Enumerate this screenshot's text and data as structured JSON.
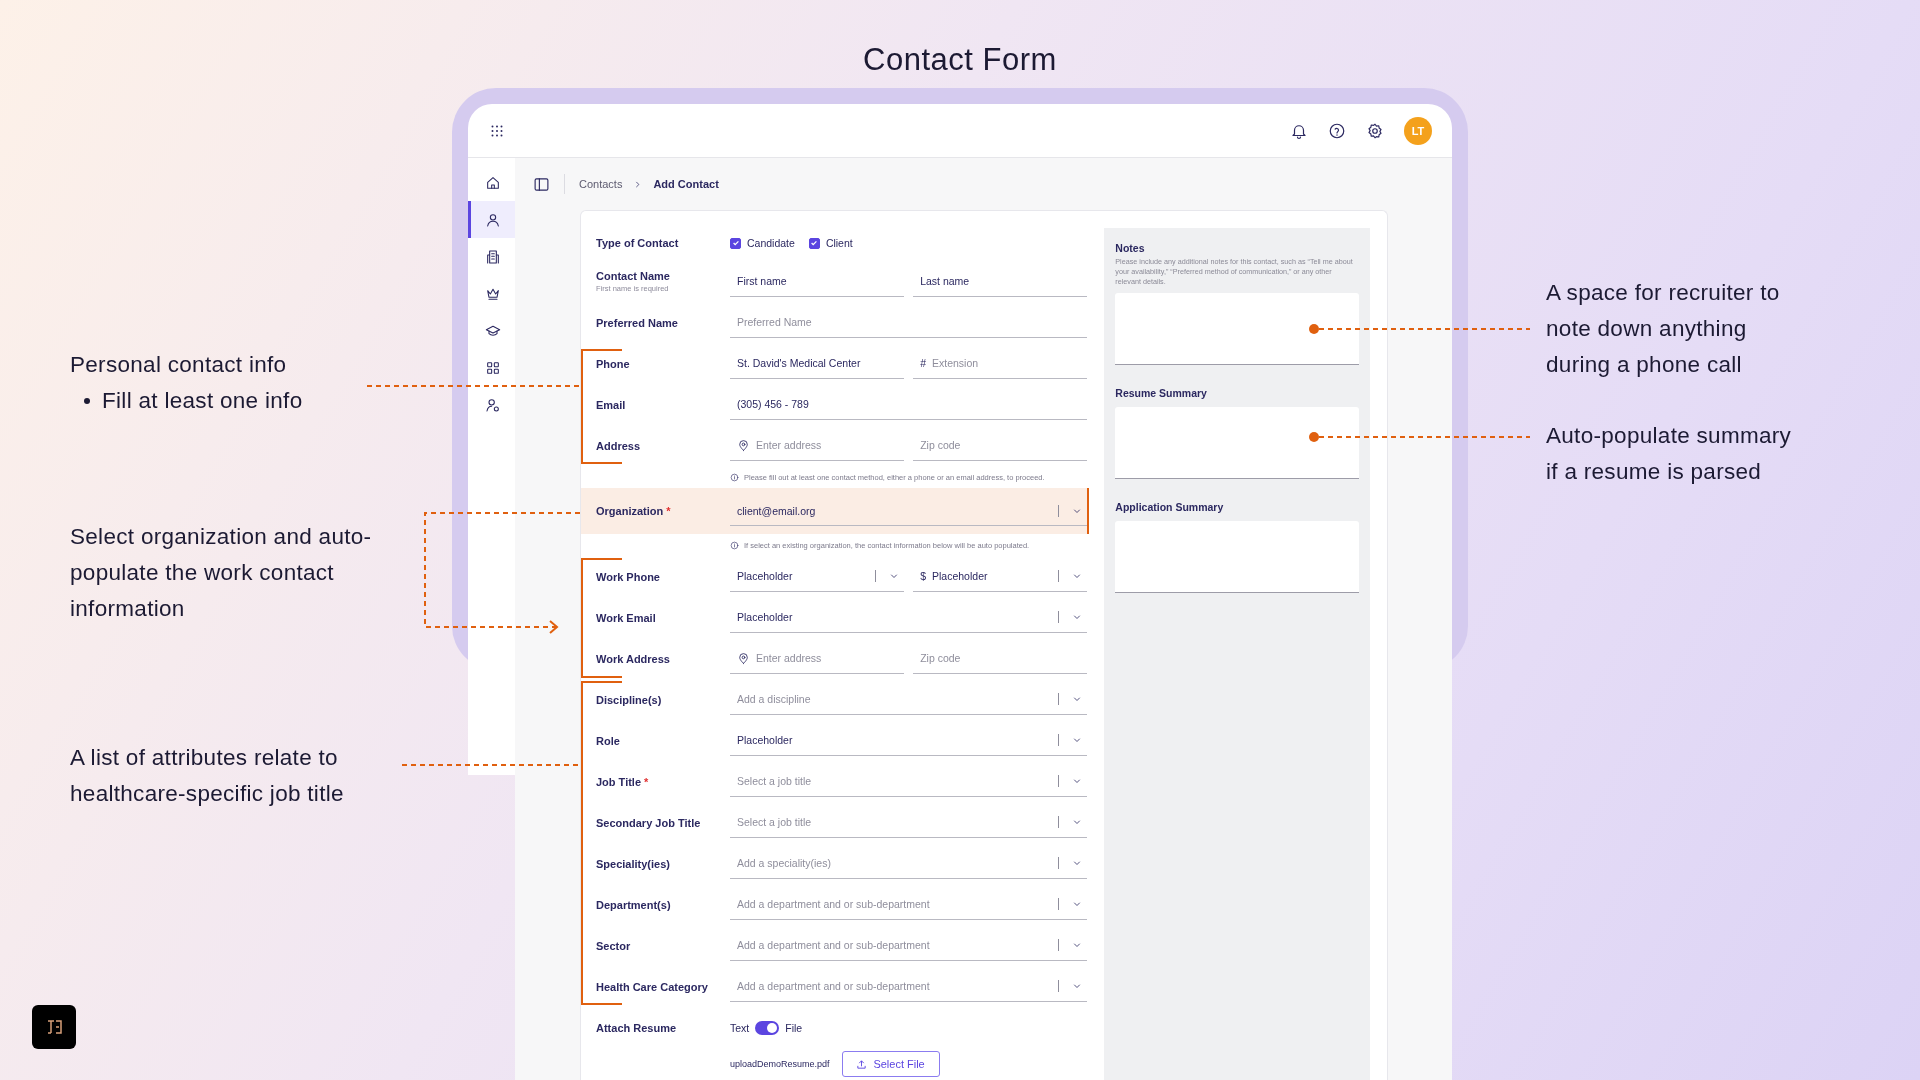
{
  "slide_title": "Contact Form",
  "app": {
    "avatar": "LT",
    "sidebar": [
      {
        "selected": false
      },
      {
        "selected": true
      },
      {
        "selected": false
      },
      {
        "selected": false
      },
      {
        "selected": false
      },
      {
        "selected": false
      },
      {
        "selected": false
      }
    ],
    "breadcrumb": [
      "Contacts",
      "Add Contact"
    ],
    "rows": [
      {
        "kind": "checkboxes",
        "label": "Type of Contact",
        "options": [
          {
            "label": "Candidate",
            "checked": true
          },
          {
            "label": "Client",
            "checked": true
          }
        ]
      },
      {
        "kind": "fields",
        "label": "Contact Name",
        "sublabel": "First name is required",
        "highlighted": false,
        "fields": [
          {
            "kind": "text",
            "value": "First name"
          },
          {
            "kind": "text",
            "value": "Last name"
          }
        ]
      },
      {
        "kind": "fields",
        "label": "Preferred Name",
        "highlighted": false,
        "fields": [
          {
            "kind": "text",
            "placeholder": "Preferred Name"
          }
        ]
      },
      {
        "kind": "fields",
        "label": "Phone",
        "highlighted": false,
        "fields": [
          {
            "kind": "text",
            "value": "St. David's Medical Center"
          },
          {
            "kind": "text",
            "prefix": "#",
            "placeholder": "Extension"
          }
        ]
      },
      {
        "kind": "fields",
        "label": "Email",
        "highlighted": false,
        "fields": [
          {
            "kind": "text",
            "value": "(305) 456 - 789"
          }
        ]
      },
      {
        "kind": "fields",
        "label": "Address",
        "highlighted": false,
        "fields": [
          {
            "kind": "address",
            "placeholder": "Enter address"
          },
          {
            "kind": "text",
            "placeholder": "Zip code"
          }
        ]
      },
      {
        "kind": "hint",
        "text": "Please fill out at least one contact method, either a phone or an email address, to proceed."
      },
      {
        "kind": "fields",
        "label": "Organization",
        "marker": "*",
        "highlighted": true,
        "fields": [
          {
            "kind": "select",
            "value": "client@email.org"
          }
        ]
      },
      {
        "kind": "hint",
        "text": "If select an existing organization, the contact information below will be auto populated."
      },
      {
        "kind": "fields",
        "label": "Work Phone",
        "highlighted": false,
        "fields": [
          {
            "kind": "select",
            "value": "Placeholder"
          },
          {
            "kind": "select",
            "prefix": "$",
            "value": "Placeholder"
          }
        ]
      },
      {
        "kind": "fields",
        "label": "Work Email",
        "highlighted": false,
        "fields": [
          {
            "kind": "select",
            "value": "Placeholder"
          }
        ]
      },
      {
        "kind": "fields",
        "label": "Work Address",
        "highlighted": false,
        "fields": [
          {
            "kind": "address",
            "placeholder": "Enter address"
          },
          {
            "kind": "text",
            "placeholder": "Zip code"
          }
        ]
      },
      {
        "kind": "fields",
        "label": "Discipline(s)",
        "highlighted": false,
        "fields": [
          {
            "kind": "select",
            "placeholder": "Add a discipline"
          }
        ]
      },
      {
        "kind": "fields",
        "label": "Role",
        "highlighted": false,
        "fields": [
          {
            "kind": "select",
            "value": "Placeholder"
          }
        ]
      },
      {
        "kind": "fields",
        "label": "Job Title",
        "marker": "*",
        "highlighted": false,
        "fields": [
          {
            "kind": "select",
            "placeholder": "Select a job title"
          }
        ]
      },
      {
        "kind": "fields",
        "label": "Secondary Job Title",
        "highlighted": false,
        "fields": [
          {
            "kind": "select",
            "placeholder": "Select a job title"
          }
        ]
      },
      {
        "kind": "fields",
        "label": "Speciality(ies)",
        "highlighted": false,
        "fields": [
          {
            "kind": "select",
            "placeholder": "Add a speciality(ies)"
          }
        ]
      },
      {
        "kind": "fields",
        "label": "Department(s)",
        "highlighted": false,
        "fields": [
          {
            "kind": "select",
            "placeholder": "Add a department and or sub-department"
          }
        ]
      },
      {
        "kind": "fields",
        "label": "Sector",
        "highlighted": false,
        "fields": [
          {
            "kind": "select",
            "placeholder": "Add a department and or sub-department"
          }
        ]
      },
      {
        "kind": "fields",
        "label": "Health Care Category",
        "highlighted": false,
        "fields": [
          {
            "kind": "select",
            "placeholder": "Add a department and or sub-department"
          }
        ]
      },
      {
        "kind": "toggle",
        "label": "Attach Resume",
        "off_label": "Text",
        "on_label": "File",
        "on": true,
        "file": "uploadDemoResume.pdf",
        "button": "Select File"
      }
    ],
    "panel": [
      {
        "title": "Notes",
        "description": "Please include any additional notes for this contact, such as “Tell me about your availability,” “Preferred method of communication,” or any other relevant details."
      },
      {
        "title": "Resume Summary"
      },
      {
        "title": "Application Summary"
      }
    ]
  },
  "annotations": {
    "left": [
      {
        "lines": [
          "Personal contact info"
        ],
        "bullets": [
          "Fill at least one info"
        ]
      },
      {
        "lines": [
          "Select organization and auto-",
          "populate the work contact",
          "information"
        ]
      },
      {
        "lines": [
          "A list of attributes relate to",
          "healthcare-specific job title"
        ]
      }
    ],
    "right": [
      {
        "lines": [
          "A space for recruiter to",
          "note down anything",
          "during a phone call"
        ]
      },
      {
        "lines": [
          "Auto-populate summary",
          "if a resume is parsed"
        ]
      }
    ]
  }
}
